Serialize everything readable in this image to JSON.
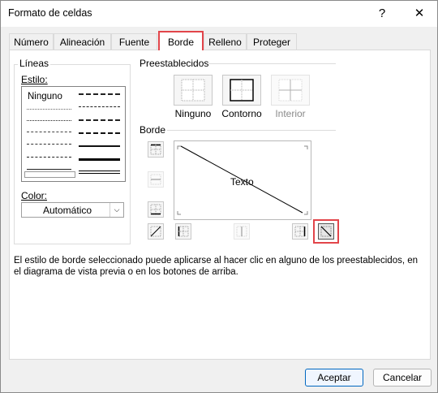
{
  "window": {
    "title": "Formato de celdas",
    "help_label": "?",
    "close_label": "✕"
  },
  "tabs": [
    {
      "label": "Número",
      "active": false
    },
    {
      "label": "Alineación",
      "active": false
    },
    {
      "label": "Fuente",
      "active": false
    },
    {
      "label": "Borde",
      "active": true
    },
    {
      "label": "Relleno",
      "active": false
    },
    {
      "label": "Proteger",
      "active": false
    }
  ],
  "lines": {
    "group_label": "Líneas",
    "style_label": "Estilo:",
    "none_label": "Ninguno",
    "color_label": "Color:",
    "color_value": "Automático"
  },
  "presets": {
    "group_label": "Preestablecidos",
    "items": [
      {
        "label": "Ninguno",
        "icon": "preset-none-icon",
        "enabled": true
      },
      {
        "label": "Contorno",
        "icon": "preset-outline-icon",
        "enabled": true
      },
      {
        "label": "Interior",
        "icon": "preset-inside-icon",
        "enabled": false
      }
    ]
  },
  "border": {
    "group_label": "Borde",
    "preview_text": "Texto",
    "buttons": [
      {
        "icon": "border-top-icon",
        "enabled": true
      },
      {
        "icon": "border-middle-horizontal-icon",
        "enabled": false
      },
      {
        "icon": "border-bottom-icon",
        "enabled": true
      },
      {
        "icon": "border-diagonal-up-icon",
        "enabled": true
      },
      {
        "icon": "border-left-icon",
        "enabled": true
      },
      {
        "icon": "border-middle-vertical-icon",
        "enabled": false
      },
      {
        "icon": "border-right-icon",
        "enabled": true
      },
      {
        "icon": "border-diagonal-down-icon",
        "enabled": true,
        "selected": true
      }
    ]
  },
  "info_text": "El estilo de borde seleccionado puede aplicarse al hacer clic en alguno de los preestablecidos, en el diagrama de vista previa o en los botones de arriba.",
  "footer": {
    "ok_label": "Aceptar",
    "cancel_label": "Cancelar"
  },
  "colors": {
    "highlight": "#e2454a",
    "accent": "#0067c0"
  }
}
